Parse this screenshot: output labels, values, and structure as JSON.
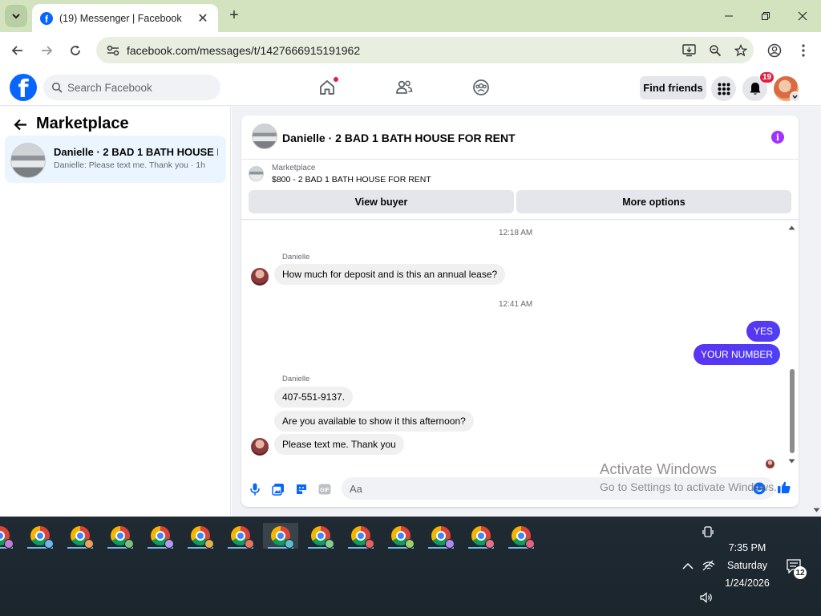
{
  "browser": {
    "tab_title": "(19) Messenger | Facebook",
    "url": "facebook.com/messages/t/1427666915191962",
    "new_tab_label": "+",
    "tab_close_label": "✕"
  },
  "facebook": {
    "logo_letter": "f",
    "search_placeholder": "Search Facebook",
    "find_friends": "Find friends",
    "notification_count": "19"
  },
  "left_panel": {
    "title": "Marketplace",
    "conversation": {
      "name": "Danielle · 2 BAD 1 BATH HOUSE F...",
      "snippet": "Danielle: Please text me. Thank you · 1h"
    }
  },
  "chat": {
    "header_title": "Danielle · 2 BAD 1 BATH HOUSE FOR RENT",
    "marketplace_label": "Marketplace",
    "listing": "$800 - 2 BAD 1 BATH HOUSE FOR RENT",
    "view_buyer": "View buyer",
    "more_options": "More options",
    "timestamp_1": "12:18 AM",
    "sender_1": "Danielle",
    "msg_1": "How much for deposit and is this an annual lease?",
    "timestamp_2": "12:41 AM",
    "out_1": "YES",
    "out_2": "YOUR NUMBER",
    "sender_2": "Danielle",
    "msg_2": "407-551-9137.",
    "msg_3": "Are you available to show it this afternoon?",
    "msg_4": "Please text me. Thank you",
    "composer_placeholder": "Aa"
  },
  "watermark": {
    "line1": "Activate Windows",
    "line2": "Go to Settings to activate Windows."
  },
  "taskbar": {
    "time": "7:35 PM",
    "day": "Saturday",
    "date": "1/24/2026",
    "notification_count": "12",
    "profile_colors": [
      "#c77dd6",
      "#6fb7e8",
      "#f0a05a",
      "#7ec07a",
      "#b19af0",
      "#e6b04a",
      "#e8765f",
      "#5bbfd0",
      "#7fd08a",
      "#e86060",
      "#9bd06a",
      "#b088f0",
      "#e87088",
      "#e86080"
    ]
  },
  "colors": {
    "fb_blue": "#0866ff",
    "outgoing_bubble": "#5a34f2",
    "active_convo_bg": "#ebf5ff",
    "badge_red": "#e41e3f"
  }
}
